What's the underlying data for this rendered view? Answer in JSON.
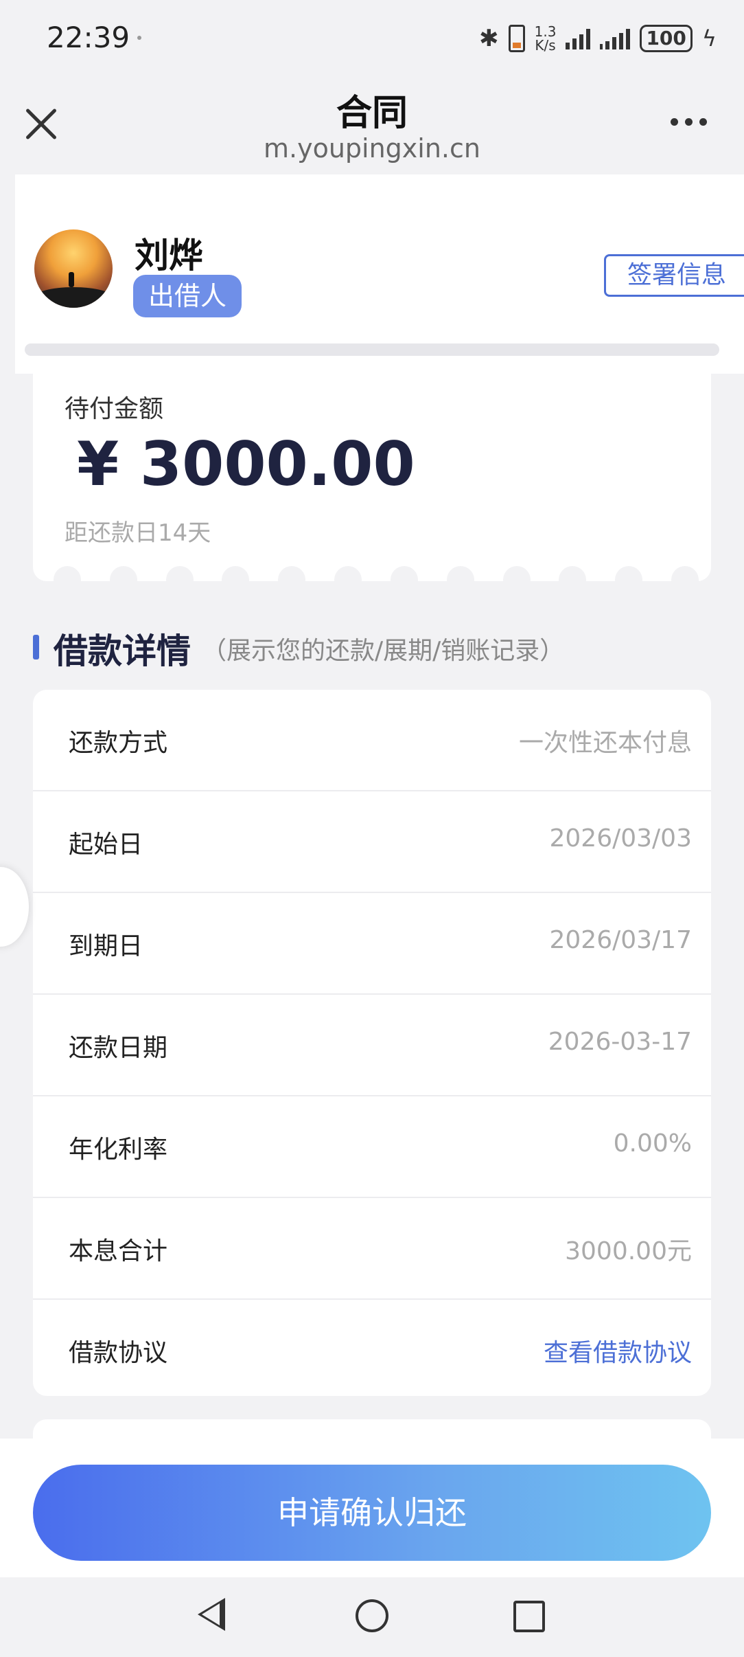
{
  "status": {
    "time": "22:39",
    "net_speed_top": "1.3",
    "net_speed_bottom": "K/s",
    "battery": "100",
    "icons": [
      "bluetooth-icon",
      "phone-icon",
      "signal-icon",
      "signal-icon",
      "battery-icon",
      "charging-icon"
    ]
  },
  "titlebar": {
    "title": "合同",
    "url": "m.youpingxin.cn"
  },
  "user": {
    "name": "刘烨",
    "role": "出借人",
    "sign_info_label": "签署信息"
  },
  "amount": {
    "label": "待付金额",
    "value": "¥ 3000.00",
    "days_left": "距还款日14天"
  },
  "section": {
    "title": "借款详情",
    "subtitle": "（展示您的还款/展期/销账记录）"
  },
  "details": [
    {
      "label": "还款方式",
      "value": "一次性还本付息"
    },
    {
      "label": "起始日",
      "value": "2026/03/03"
    },
    {
      "label": "到期日",
      "value": "2026/03/17"
    },
    {
      "label": "还款日期",
      "value": "2026-03-17"
    },
    {
      "label": "年化利率",
      "value": "0.00%"
    },
    {
      "label": "本息合计",
      "value": "3000.00元"
    },
    {
      "label": "借款协议",
      "value": "查看借款协议"
    }
  ],
  "action": {
    "confirm_label": "申请确认归还"
  },
  "colors": {
    "accent": "#4c6fd6",
    "badge": "#6f8fe8",
    "button_gradient_start": "#4a6ded",
    "button_gradient_end": "#6ec3f0"
  }
}
